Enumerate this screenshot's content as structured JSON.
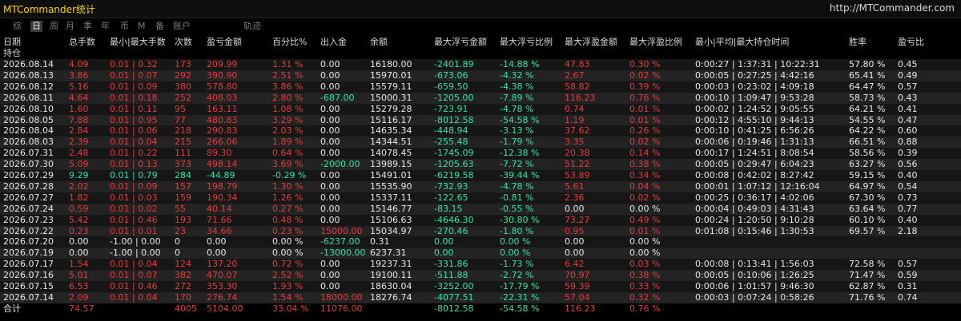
{
  "app": {
    "title": "MTCommander统计",
    "url": "http://MTCommander.com"
  },
  "tabs": [
    {
      "label": "综",
      "active": false
    },
    {
      "label": "日",
      "active": true
    },
    {
      "label": "周",
      "active": false
    },
    {
      "label": "月",
      "active": false
    },
    {
      "label": "季",
      "active": false
    },
    {
      "label": "年",
      "active": false
    },
    {
      "label": "币",
      "active": false
    },
    {
      "label": "M",
      "active": false
    },
    {
      "label": "备",
      "active": false
    },
    {
      "label": "账户",
      "active": false
    },
    {
      "label": "轨迹",
      "active": false
    }
  ],
  "columns": [
    "日期",
    "总手数",
    "最小|最大手数",
    "次数",
    "盈亏金额",
    "百分比%",
    "出入金",
    "余额",
    "最大浮亏金额",
    "最大浮亏比例",
    "最大浮盈金额",
    "最大浮盈比例",
    "最小|平均|最大持仓时间",
    "胜率",
    "盈亏比"
  ],
  "column_sub": "持仓",
  "rows": [
    [
      "2026.08.14",
      "4.09",
      "0.01 | 0.32",
      "173",
      "209.99",
      "1.31 %",
      "0.00",
      "16180.00",
      "-2401.89",
      "-14.88 %",
      "47.83",
      "0.30 %",
      "0:00:27 | 1:37:31 | 10:22:31",
      "57.80 %",
      "0.45"
    ],
    [
      "2026.08.13",
      "3.86",
      "0.01 | 0.07",
      "292",
      "390.90",
      "2.51 %",
      "0.00",
      "15970.01",
      "-673.06",
      "-4.32 %",
      "2.67",
      "0.02 %",
      "0:00:05 | 0:27:25 | 4:42:16",
      "65.41 %",
      "0.49"
    ],
    [
      "2026.08.12",
      "5.16",
      "0.01 | 0.09",
      "380",
      "578.80",
      "3.86 %",
      "0.00",
      "15579.11",
      "-659.50",
      "-4.38 %",
      "58.82",
      "0.39 %",
      "0:00:03 | 0:23:02 | 4:09:18",
      "64.47 %",
      "0.57"
    ],
    [
      "2026.08.11",
      "4.64",
      "0.01 | 0.18",
      "252",
      "408.03",
      "2.80 %",
      "-687.00",
      "15000.31",
      "-1205.00",
      "-7.89 %",
      "116.23",
      "0.76 %",
      "0:00:10 | 1:09:47 | 9:53:28",
      "58.73 %",
      "0.43"
    ],
    [
      "2026.08.10",
      "1.60",
      "0.01 | 0.11",
      "95",
      "163.11",
      "1.08 %",
      "0.00",
      "15279.28",
      "-723.91",
      "-4.78 %",
      "0.74",
      "0.01 %",
      "0:00:02 | 1:24:52 | 9:05:55",
      "64.21 %",
      "0.41"
    ],
    [
      "2026.08.05",
      "7.88",
      "0.01 | 0.95",
      "77",
      "480.83",
      "3.29 %",
      "0.00",
      "15116.17",
      "-8012.58",
      "-54.58 %",
      "1.19",
      "0.01 %",
      "0:00:12 | 4:55:10 | 9:44:13",
      "54.55 %",
      "0.47"
    ],
    [
      "2026.08.04",
      "2.84",
      "0.01 | 0.06",
      "218",
      "290.83",
      "2.03 %",
      "0.00",
      "14635.34",
      "-448.94",
      "-3.13 %",
      "37.62",
      "0.26 %",
      "0:00:10 | 0:41:25 | 6:56:26",
      "64.22 %",
      "0.60"
    ],
    [
      "2026.08.03",
      "2.39",
      "0.01 | 0.04",
      "215",
      "266.06",
      "1.89 %",
      "0.00",
      "14344.51",
      "-255.48",
      "-1.79 %",
      "3.35",
      "0.02 %",
      "0:00:06 | 0:19:46 | 1:31:13",
      "66.51 %",
      "0.88"
    ],
    [
      "2026.07.31",
      "2.48",
      "0.01 | 0.22",
      "111",
      "89.30",
      "0.64 %",
      "0.00",
      "14078.45",
      "-1745.09",
      "-12.38 %",
      "20.38",
      "0.14 %",
      "0:00:17 | 1:24:51 | 8:08:54",
      "58.56 %",
      "0.39"
    ],
    [
      "2026.07.30",
      "5.09",
      "0.01 | 0.13",
      "373",
      "498.14",
      "3.69 %",
      "-2000.00",
      "13989.15",
      "-1205.63",
      "-7.72 %",
      "51.22",
      "0.38 %",
      "0:00:05 | 0:29:47 | 6:04:23",
      "63.27 %",
      "0.56"
    ],
    [
      "2026.07.29",
      "9.29",
      "0.01 | 0.79",
      "284",
      "-44.89",
      "-0.29 %",
      "0.00",
      "15491.01",
      "-6219.58",
      "-39.44 %",
      "53.89",
      "0.34 %",
      "0:00:08 | 0:42:02 | 8:27:42",
      "59.15 %",
      "0.40"
    ],
    [
      "2026.07.28",
      "2.02",
      "0.01 | 0.09",
      "157",
      "198.79",
      "1.30 %",
      "0.00",
      "15535.90",
      "-732.93",
      "-4.78 %",
      "5.61",
      "0.04 %",
      "0:00:01 | 1:07:12 | 12:16:04",
      "64.97 %",
      "0.54"
    ],
    [
      "2026.07.27",
      "1.82",
      "0.01 | 0.03",
      "159",
      "190.34",
      "1.26 %",
      "0.00",
      "15337.11",
      "-122.65",
      "-0.81 %",
      "2.36",
      "0.02 %",
      "0:00:25 | 0:36:17 | 4:02:06",
      "67.30 %",
      "0.73"
    ],
    [
      "2026.07.24",
      "0.59",
      "0.01 | 0.02",
      "55",
      "40.14",
      "0.27 %",
      "0.00",
      "15146.77",
      "-83.15",
      "-0.55 %",
      "0.00",
      "0.00 %",
      "0:00:04 | 0:49:03 | 4:31:43",
      "63.64 %",
      "0.77"
    ],
    [
      "2026.07.23",
      "5.42",
      "0.01 | 0.46",
      "193",
      "71.66",
      "0.48 %",
      "0.00",
      "15106.63",
      "-4646.30",
      "-30.80 %",
      "73.27",
      "0.49 %",
      "0:00:24 | 1:20:50 | 9:10:28",
      "60.10 %",
      "0.40"
    ],
    [
      "2026.07.22",
      "0.23",
      "0.01 | 0.01",
      "23",
      "34.66",
      "0.23 %",
      "15000.00",
      "15034.97",
      "-270.46",
      "-1.80 %",
      "0.95",
      "0.01 %",
      "0:01:08 | 0:15:46 | 1:30:53",
      "69.57 %",
      "2.18"
    ],
    [
      "2026.07.20",
      "0.00",
      "-1.00 | 0.00",
      "0",
      "0.00",
      "0.00 %",
      "-6237.00",
      "0.31",
      "0.00",
      "0.00 %",
      "0.00",
      "0.00 %",
      "",
      "",
      ""
    ],
    [
      "2026.07.19",
      "0.00",
      "-1.00 | 0.00",
      "0",
      "0.00",
      "0.00 %",
      "-13000.00",
      "6237.31",
      "0.00",
      "0.00 %",
      "0.00",
      "0.00 %",
      "",
      "",
      ""
    ],
    [
      "2026.07.17",
      "1.54",
      "0.01 | 0.04",
      "124",
      "137.20",
      "0.72 %",
      "0.00",
      "19237.31",
      "-331.86",
      "-1.73 %",
      "6.42",
      "0.03 %",
      "0:00:08 | 0:13:41 | 1:56:03",
      "72.58 %",
      "0.57"
    ],
    [
      "2026.07.16",
      "5.01",
      "0.01 | 0.07",
      "382",
      "470.07",
      "2.52 %",
      "0.00",
      "19100.11",
      "-511.88",
      "-2.72 %",
      "70.97",
      "0.38 %",
      "0:00:05 | 0:10:06 | 1:26:25",
      "71.47 %",
      "0.59"
    ],
    [
      "2026.07.15",
      "6.53",
      "0.01 | 0.46",
      "272",
      "353.30",
      "1.93 %",
      "0.00",
      "18630.04",
      "-3252.00",
      "-17.79 %",
      "59.39",
      "0.33 %",
      "0:00:06 | 1:01:57 | 9:46:30",
      "62.87 %",
      "0.31"
    ],
    [
      "2026.07.14",
      "2.09",
      "0.01 | 0.04",
      "170",
      "276.74",
      "1.54 %",
      "18000.00",
      "18276.74",
      "-4077.51",
      "-22.31 %",
      "57.04",
      "0.32 %",
      "0:00:03 | 0:07:24 | 0:58:26",
      "71.76 %",
      "0.74"
    ]
  ],
  "total": [
    "合计",
    "74.57",
    "",
    "4005",
    "5104.00",
    "33.04 %",
    "11076.00",
    "",
    "-8012.58",
    "-54.58 %",
    "116.23",
    "0.76 %",
    "",
    "",
    ""
  ],
  "colors": {
    "positive": "#e83b3b",
    "negative": "#2ee6a6",
    "title": "#ffd400",
    "background": "#000000"
  }
}
